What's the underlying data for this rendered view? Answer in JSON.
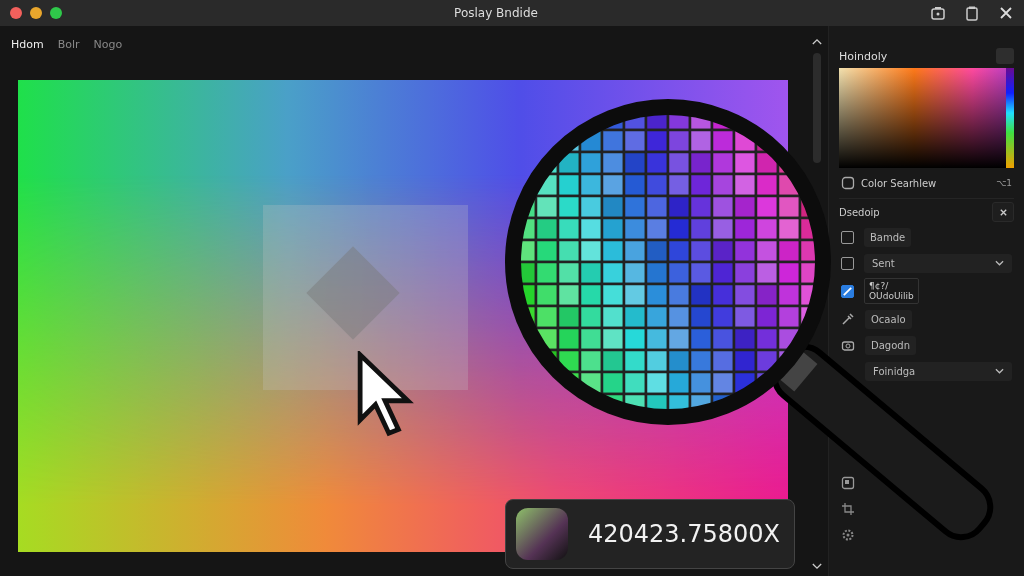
{
  "window": {
    "title": "Poslay Bndide"
  },
  "tabs": [
    {
      "label": "Hdom",
      "selected": true
    },
    {
      "label": "Bolr",
      "selected": false
    },
    {
      "label": "Nogo",
      "selected": false
    }
  ],
  "readout": {
    "value": "420423.75800X"
  },
  "panel": {
    "title": "Hoindoly",
    "searchlight": {
      "label": "Color Searhlew",
      "shortcut": "⌥1"
    },
    "section": {
      "title": "Dsedoip"
    },
    "options": [
      {
        "kind": "check",
        "label": "Bamde",
        "checked": false
      },
      {
        "kind": "select",
        "label": "Sent",
        "checked": false
      },
      {
        "kind": "check2",
        "label": "¶¢?/",
        "sublabel": "OUdoUilib",
        "checked": true
      }
    ],
    "tools": [
      {
        "kind": "eyedropper",
        "label": "Ocaalo"
      },
      {
        "kind": "camera",
        "label": "Dagodn"
      },
      {
        "kind": "dropdown",
        "label": "Foinidga"
      }
    ]
  }
}
